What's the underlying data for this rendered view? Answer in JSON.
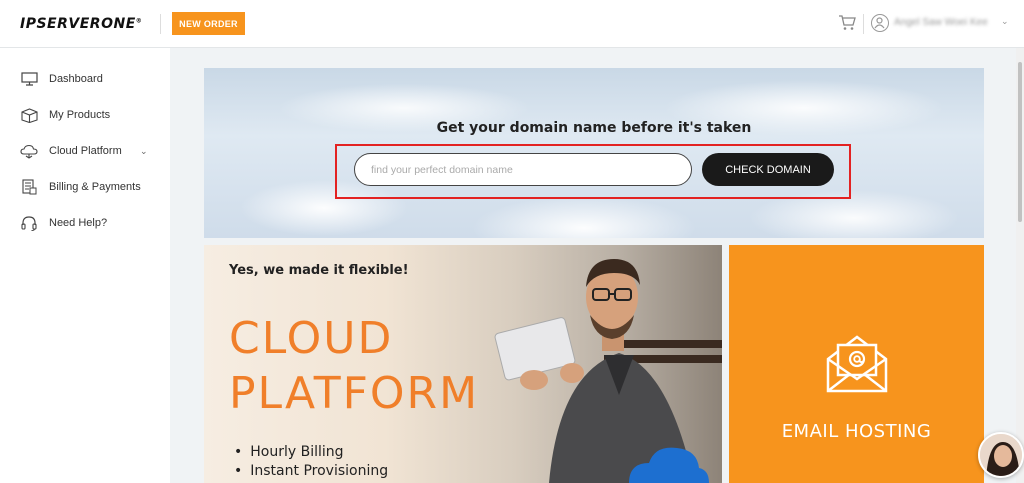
{
  "header": {
    "logo_text": "IPSERVERONE",
    "logo_mark": "®",
    "new_order_label": "NEW ORDER",
    "user_name": "Angel Saw Woei Kee"
  },
  "sidebar": {
    "items": [
      {
        "label": "Dashboard",
        "icon": "monitor-icon"
      },
      {
        "label": "My Products",
        "icon": "box-icon"
      },
      {
        "label": "Cloud Platform",
        "icon": "cloud-icon",
        "has_submenu": true
      },
      {
        "label": "Billing & Payments",
        "icon": "invoice-icon"
      },
      {
        "label": "Need Help?",
        "icon": "headset-icon"
      }
    ]
  },
  "hero": {
    "title": "Get your domain name before it's taken",
    "input_placeholder": "find your perfect domain name",
    "input_value": "",
    "button_label": "CHECK DOMAIN"
  },
  "cloud_card": {
    "tagline": "Yes, we made it flexible!",
    "title_line1": "CLOUD",
    "title_line2": "PLATFORM",
    "bullets": [
      "Hourly Billing",
      "Instant Provisioning"
    ]
  },
  "email_card": {
    "title": "EMAIL HOSTING"
  },
  "colors": {
    "accent": "#f7941d",
    "cloud_title": "#f07f2a",
    "highlight": "#e32222"
  }
}
